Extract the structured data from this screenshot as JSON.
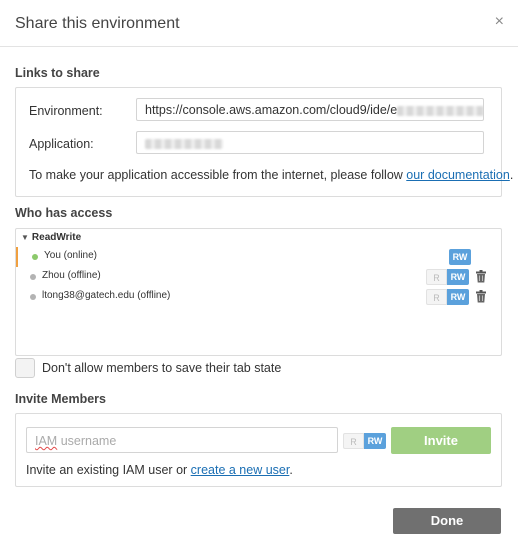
{
  "dialog": {
    "title": "Share this environment",
    "close_glyph": "×"
  },
  "links": {
    "section_title": "Links to share",
    "environment_label": "Environment:",
    "environment_value": "https://console.aws.amazon.com/cloud9/ide/e",
    "application_label": "Application:",
    "info_text": "To make your application accessible from the internet, please follow ",
    "info_link": "our documentation",
    "info_end": "."
  },
  "access": {
    "section_title": "Who has access",
    "group_label": "ReadWrite",
    "members": [
      {
        "name": "You (online)",
        "status_color": "#8cc96b",
        "show_r": false,
        "permission": "RW",
        "removable": false
      },
      {
        "name": "Zhou (offline)",
        "status_color": "#b3b3b3",
        "show_r": true,
        "permission": "RW",
        "removable": true
      },
      {
        "name": "ltong38@gatech.edu (offline)",
        "status_color": "#b3b3b3",
        "show_r": true,
        "permission": "RW",
        "removable": true
      }
    ],
    "r_label": "R",
    "rw_label": "RW"
  },
  "tab_state": {
    "label": "Don't allow members to save their tab state",
    "checked": false
  },
  "invite": {
    "section_title": "Invite Members",
    "input_placeholder_prefix": "IAM",
    "input_placeholder_rest": " username",
    "r_label": "R",
    "rw_label": "RW",
    "button_label": "Invite",
    "hint_text": "Invite an existing IAM user or ",
    "hint_link": "create a new user",
    "hint_end": "."
  },
  "footer": {
    "done_label": "Done"
  },
  "colors": {
    "accent_blue": "#5ba1dc",
    "invite_green": "#a0cf82",
    "done_gray": "#707070",
    "online_green": "#8cc96b",
    "offline_gray": "#b3b3b3",
    "active_marker": "#f0a040"
  }
}
